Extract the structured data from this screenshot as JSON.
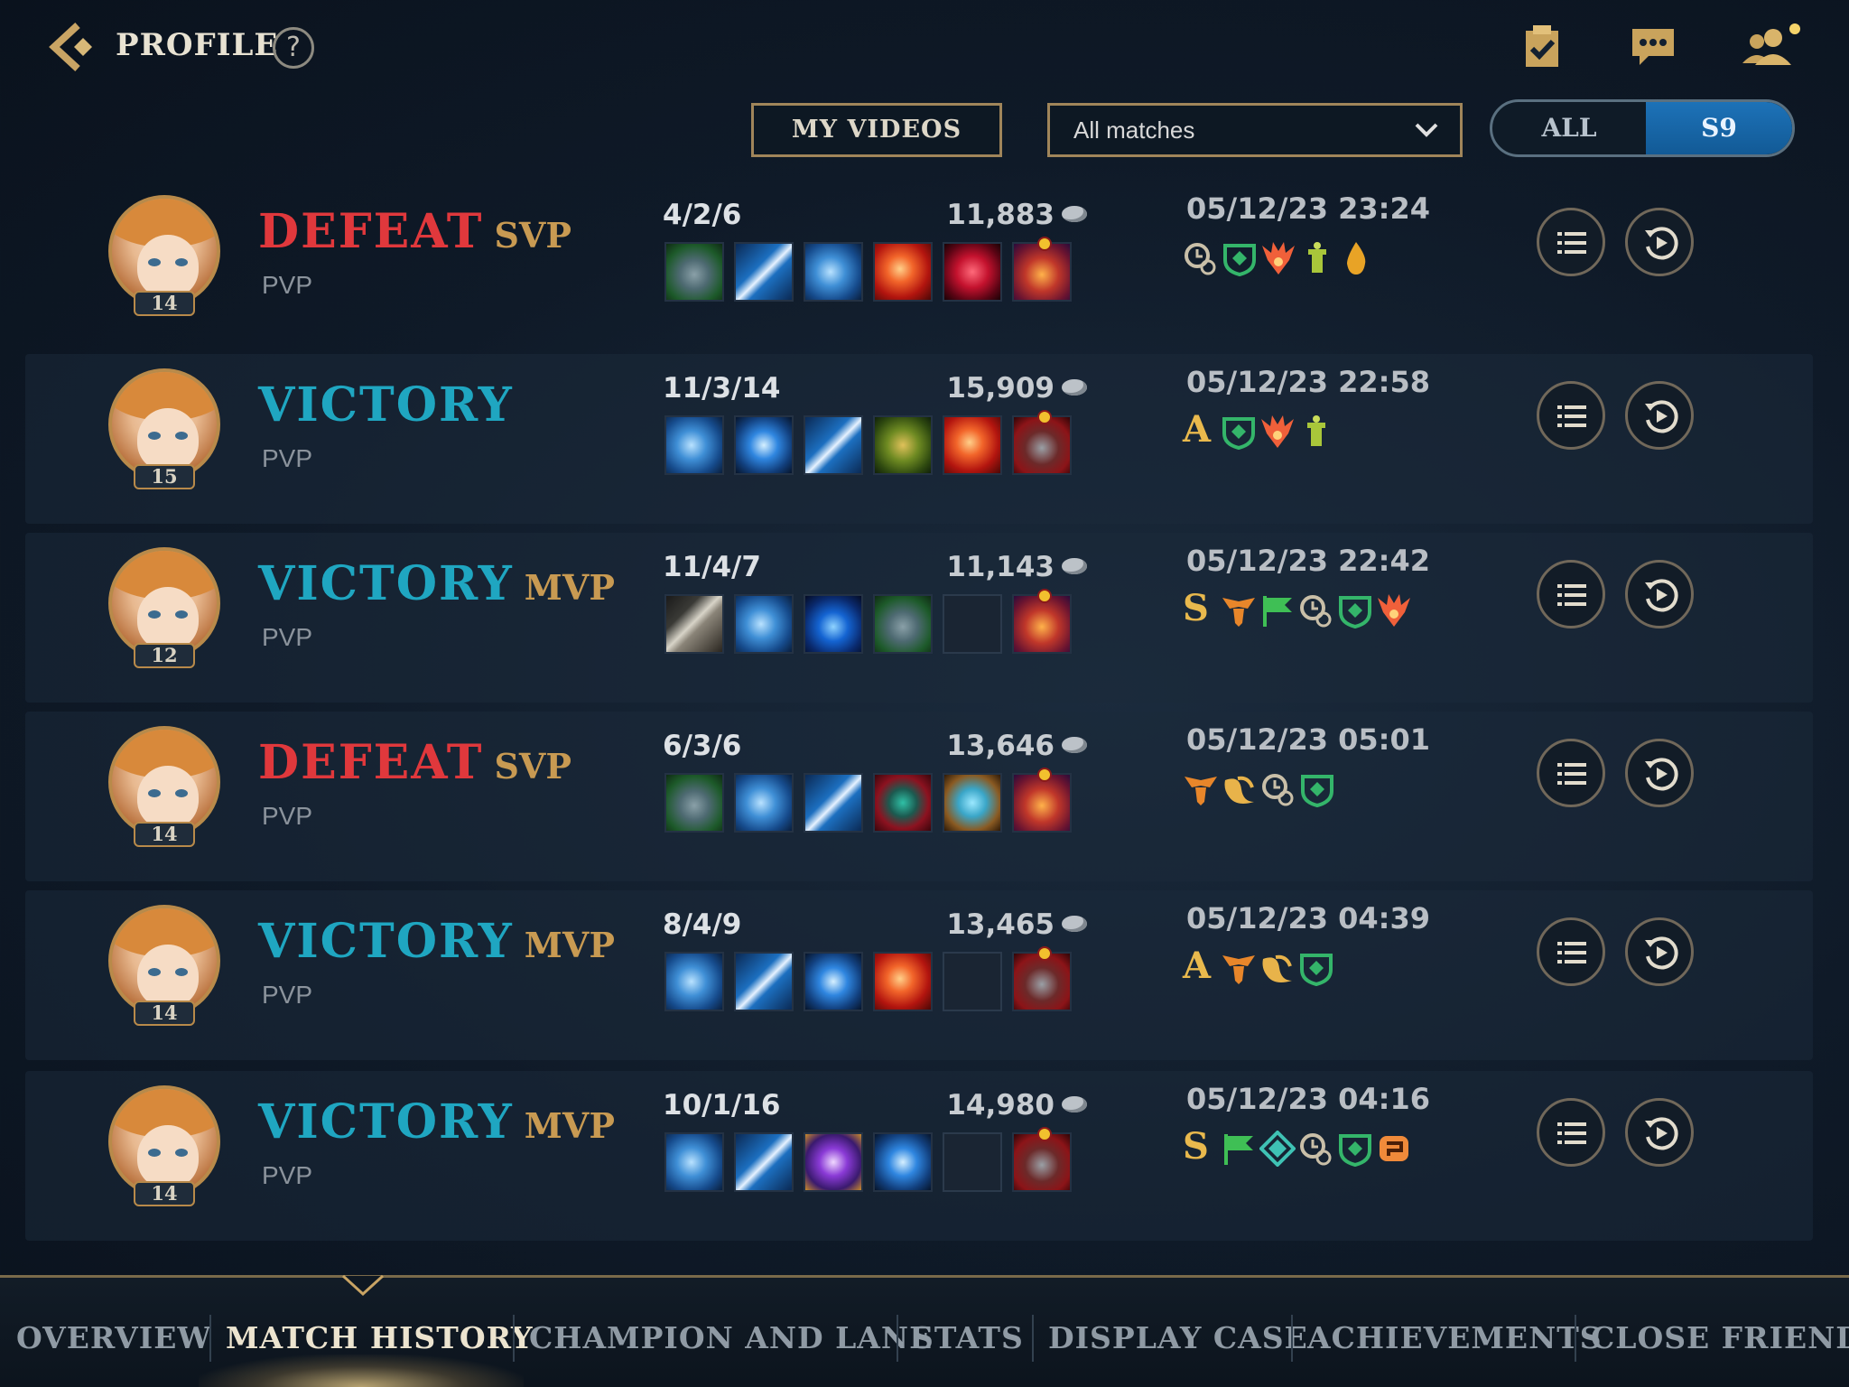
{
  "header": {
    "title": "PROFILE",
    "help": "?"
  },
  "filters": {
    "my_videos_label": "MY VIDEOS",
    "match_filter_value": "All matches",
    "season_all": "ALL",
    "season_current": "S9"
  },
  "colors": {
    "defeat": "#e0383c",
    "victory": "#1fa6c1",
    "gold_accent": "#c89a52",
    "season_active": "#1d72b8"
  },
  "matches": [
    {
      "result": "DEFEAT",
      "honor": "SVP",
      "mode": "PVP",
      "level": "14",
      "kda": "4/2/6",
      "gold": "11,883",
      "date": "05/12/23 23:24",
      "grade": "",
      "items": [
        "armor-green",
        "spear-blue",
        "gauntlet-blue",
        "orb-red",
        "gem-crimson",
        "boots-red-face"
      ],
      "badges": [
        "clock-link-badge",
        "shield-green-badge",
        "dragon-orange-badge",
        "tower-green-badge",
        "flame-gold-badge"
      ]
    },
    {
      "result": "VICTORY",
      "honor": "",
      "mode": "PVP",
      "level": "15",
      "kda": "11/3/14",
      "gold": "15,909",
      "date": "05/12/23 22:58",
      "grade": "A",
      "items": [
        "gauntlet-blue",
        "crystal-blue",
        "spear-blue",
        "beast-green",
        "orb-red",
        "boots-red"
      ],
      "badges": [
        "shield-green-badge",
        "dragon-orange-badge",
        "tower-green-badge"
      ]
    },
    {
      "result": "VICTORY",
      "honor": "MVP",
      "mode": "PVP",
      "level": "12",
      "kda": "11/4/7",
      "gold": "11,143",
      "date": "05/12/23 22:42",
      "grade": "S",
      "items": [
        "sword-steel",
        "gauntlet-blue",
        "drop-blue",
        "armor-green",
        "empty",
        "boots-red-face"
      ],
      "badges": [
        "wings-orange-badge",
        "flag-green-badge",
        "clock-link-badge",
        "shield-green-badge",
        "dragon-orange-badge"
      ]
    },
    {
      "result": "DEFEAT",
      "honor": "SVP",
      "mode": "PVP",
      "level": "14",
      "kda": "6/3/6",
      "gold": "13,646",
      "date": "05/12/23 05:01",
      "grade": "",
      "items": [
        "armor-green",
        "gauntlet-blue",
        "spear-blue",
        "helm-red",
        "vest-teal",
        "boots-red-face"
      ],
      "badges": [
        "wings-orange-badge",
        "wing-gold-badge",
        "clock-link-badge",
        "shield-green-badge"
      ]
    },
    {
      "result": "VICTORY",
      "honor": "MVP",
      "mode": "PVP",
      "level": "14",
      "kda": "8/4/9",
      "gold": "13,465",
      "date": "05/12/23 04:39",
      "grade": "A",
      "items": [
        "gauntlet-blue",
        "spear-blue",
        "crystal-blue",
        "orb-red",
        "empty",
        "boots-red"
      ],
      "badges": [
        "wings-orange-badge",
        "wing-gold-badge",
        "shield-green-badge"
      ]
    },
    {
      "result": "VICTORY",
      "honor": "MVP",
      "mode": "PVP",
      "level": "14",
      "kda": "10/1/16",
      "gold": "14,980",
      "date": "05/12/23 04:16",
      "grade": "S",
      "items": [
        "gauntlet-blue",
        "spear-blue",
        "star-purple",
        "crystal-blue",
        "empty",
        "boots-red"
      ],
      "badges": [
        "flag-green-badge",
        "diamond-teal-badge",
        "clock-link-badge",
        "shield-green-badge",
        "coin-orange-badge"
      ]
    }
  ],
  "tabs": [
    {
      "label": "OVERVIEW"
    },
    {
      "label": "MATCH HISTORY",
      "active": true
    },
    {
      "label": "CHAMPION AND LANE"
    },
    {
      "label": "STATS"
    },
    {
      "label": "DISPLAY CASE"
    },
    {
      "label": "ACHIEVEMENTS"
    },
    {
      "label": "CLOSE FRIENDS"
    }
  ]
}
